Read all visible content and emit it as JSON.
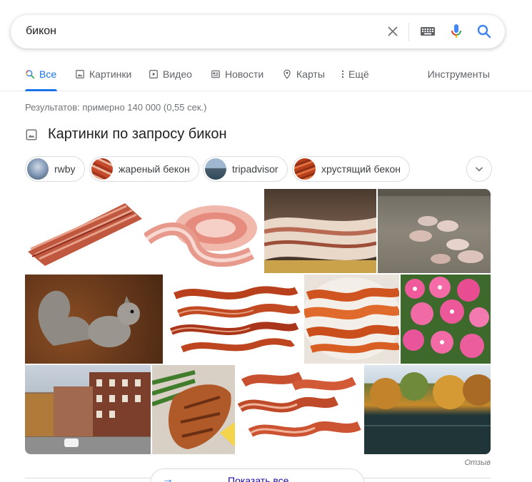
{
  "search": {
    "query": "бикон",
    "icons": [
      "close-icon",
      "keyboard-icon",
      "microphone-icon",
      "search-icon"
    ]
  },
  "tabs": [
    {
      "label": "Все",
      "icon": "search-icon",
      "active": true
    },
    {
      "label": "Картинки",
      "icon": "image-icon"
    },
    {
      "label": "Видео",
      "icon": "play-icon"
    },
    {
      "label": "Новости",
      "icon": "news-icon"
    },
    {
      "label": "Карты",
      "icon": "map-pin-icon"
    },
    {
      "label": "Ещё",
      "icon": "more-vertical-icon"
    }
  ],
  "tools_label": "Инструменты",
  "result_stats": "Результатов: примерно 140 000 (0,55 сек.)",
  "images_section": {
    "title": "Картинки по запросу бикон",
    "chips": [
      {
        "label": "rwby"
      },
      {
        "label": "жареный бекон"
      },
      {
        "label": "tripadvisor"
      },
      {
        "label": "хрустящий бекон"
      }
    ],
    "images": [
      "bacon-strips",
      "bacon-rolled",
      "bacon-slab",
      "piglets",
      "squirrel",
      "bacon-crispy",
      "bacon-plate",
      "pink-flowers",
      "street",
      "grilled-fish",
      "bacon-pieces",
      "pond"
    ],
    "feedback_label": "Отзыв",
    "show_all_label": "Показать все"
  },
  "colors": {
    "accent": "#1a73e8",
    "link": "#1a0dab",
    "muted": "#5f6368"
  }
}
